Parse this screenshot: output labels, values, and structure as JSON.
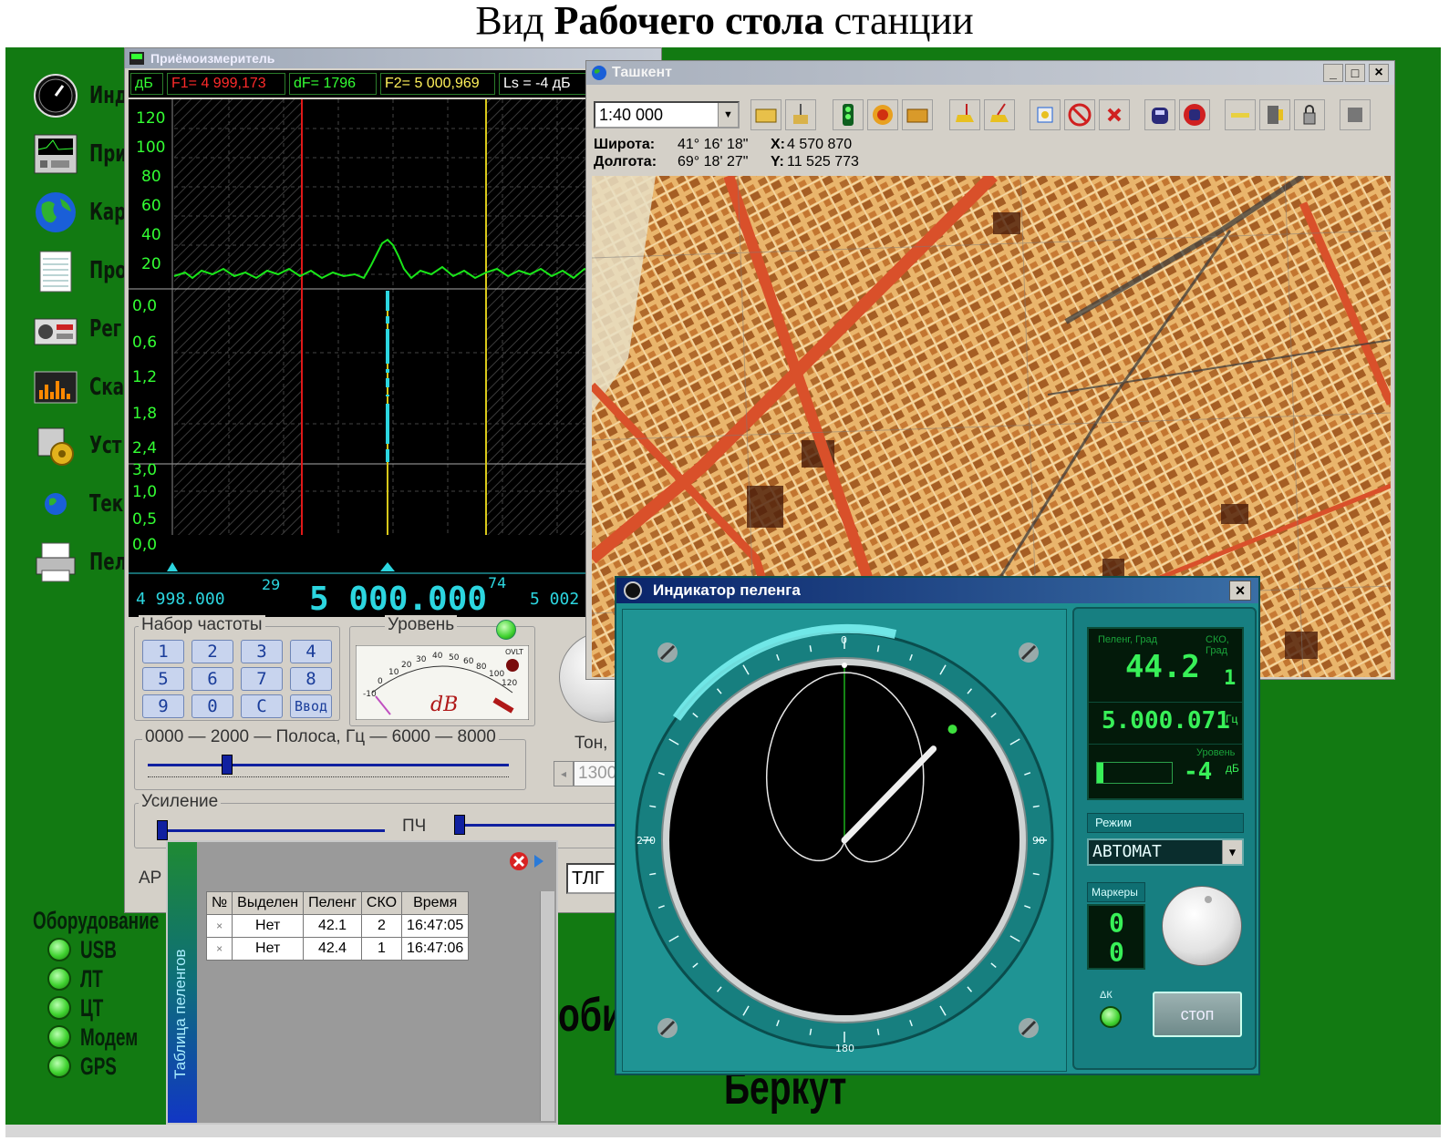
{
  "caption": {
    "pre": "Вид ",
    "bold": "Рабочего стола",
    "post": " станции"
  },
  "desktop": {
    "icons": [
      {
        "label": "Инд",
        "icon": "gauge-icon"
      },
      {
        "label": "При",
        "icon": "receiver-icon"
      },
      {
        "label": "Карт",
        "icon": "globe-icon"
      },
      {
        "label": "Про",
        "icon": "notepad-icon"
      },
      {
        "label": "Рег",
        "icon": "recorder-icon"
      },
      {
        "label": "Скан",
        "icon": "scanner-icon"
      },
      {
        "label": "Уст",
        "icon": "settings-icon"
      },
      {
        "label": "Тек",
        "icon": "globe-small-icon"
      },
      {
        "label": "Пел",
        "icon": "printer-icon"
      }
    ],
    "equipment_title": "Оборудование",
    "equipment": [
      "USB",
      "ЛТ",
      "ЦТ",
      "Модем",
      "GPS"
    ],
    "partial_text_1": "оби",
    "partial_text_2": "Беркут",
    "status_color": "#3fd22f"
  },
  "spectrum": {
    "title": "Приёмоизмеритель",
    "header": {
      "unit": "дБ",
      "f1": "F1= 4 999,173",
      "df": "dF= 1796",
      "f2": "F2= 5 000,969",
      "ls": "Ls = -4 дБ"
    },
    "y_ticks_top": [
      "120",
      "100",
      "80",
      "60",
      "40",
      "20"
    ],
    "y_ticks_mid": [
      "0,0",
      "0,6",
      "1,2",
      "1,8",
      "2,4",
      "3,0"
    ],
    "y_ticks_bot": [
      "1,0",
      "0,5",
      "0,0"
    ],
    "scale_left": "4 998.000",
    "scale_left_sup": "29",
    "scale_center": "5 000.000",
    "scale_right_sup": "74",
    "scale_right": "5 002",
    "freq_panel": {
      "title": "Набор частоты",
      "keys": [
        "1",
        "2",
        "3",
        "4",
        "5",
        "6",
        "7",
        "8",
        "9",
        "0",
        "C",
        "Ввод"
      ]
    },
    "level_panel": {
      "title": "Уровень",
      "meter_unit": "dB",
      "meter_ticks": [
        "-10",
        "0",
        "10",
        "20",
        "30",
        "40",
        "50",
        "60",
        "80",
        "100",
        "120"
      ],
      "over": "OVLT"
    },
    "band_label": "0000 — 2000 — Полоса, Гц — 6000 — 8000",
    "band_value": 0.22,
    "tone_label": "Тон,",
    "tone_value": "1300",
    "gain_title": "Усиление",
    "if_label": "ПЧ",
    "agc_label": "АР",
    "mode_value": "ТЛГ"
  },
  "map": {
    "title": "Ташкент",
    "scale": "1:40 000",
    "lat_label": "Широта:",
    "lat_value": "41° 16' 18\"",
    "lon_label": "Долгота:",
    "lon_value": "69° 18' 27\"",
    "x_label": "X:",
    "x_value": "4 570 870",
    "y_label": "Y:",
    "y_value": "11 525 773",
    "toolbar_icons": [
      "open-folder-icon",
      "station-icon",
      "traffic-light-icon",
      "target-icon",
      "vehicle-icon",
      "flag-yellow-icon",
      "flag-red-icon",
      "marker-icon",
      "cancel-icon",
      "delete-icon",
      "car-icon",
      "no-car-icon",
      "line-icon",
      "settings-icon",
      "lock-icon",
      "stop-icon"
    ],
    "win_buttons": [
      "_",
      "□",
      "×"
    ]
  },
  "bearing": {
    "title": "Индикатор пеленга",
    "close": "×",
    "dial_labels": {
      "n": "0",
      "e": "90",
      "s": "180",
      "w": "270"
    },
    "bearing_deg": 44.2,
    "lcd": {
      "bearing_label": "Пеленг, Град",
      "bearing_value": "44.2",
      "sko_label": "СКО, Град",
      "sko_value": "1",
      "freq_value": "5.000.071",
      "freq_unit": "Гц",
      "level_label": "Уровень",
      "level_value": "-4",
      "level_unit": "дБ"
    },
    "mode_label": "Режим",
    "mode_value": "АВТОМАТ",
    "markers_label": "Маркеры",
    "markers_value_1": "0",
    "markers_value_2": "0",
    "dk_label": "ΔК",
    "stop_label": "стоп"
  },
  "table": {
    "title": "Таблица пеленгов",
    "columns": [
      "№",
      "Выделен",
      "Пеленг",
      "СКО",
      "Время"
    ],
    "rows": [
      [
        "×",
        "Нет",
        "42.1",
        "2",
        "16:47:05"
      ],
      [
        "×",
        "Нет",
        "42.4",
        "1",
        "16:47:06"
      ]
    ]
  }
}
